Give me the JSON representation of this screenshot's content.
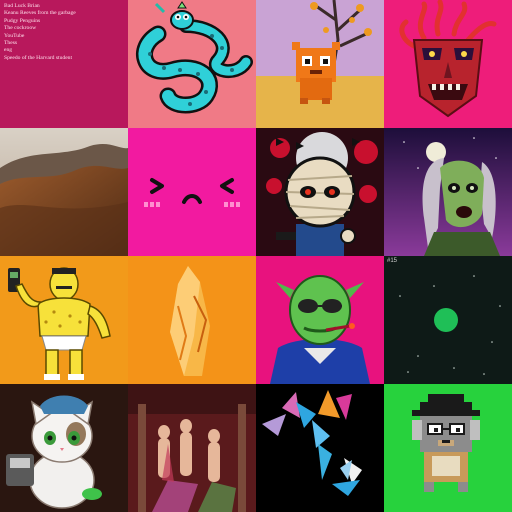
{
  "tiles": [
    {
      "id": "text-list",
      "bg": "#b8185c",
      "items": [
        "Bad Luck Brian",
        "Keanu Reeves from the garbage",
        "Pudgy Penguins",
        "The cockroow",
        "YouTube",
        "Thess",
        "eng",
        "Speedo of the Harvard student"
      ]
    },
    {
      "id": "cyan-serpent",
      "bg": "#f07a86",
      "icon": "serpent-icon"
    },
    {
      "id": "orange-voxel-creature",
      "bg": "#e2b54a",
      "icon": "voxel-creature-icon"
    },
    {
      "id": "red-tentacle-mask",
      "bg": "#ee1d7a",
      "icon": "mask-icon"
    },
    {
      "id": "desert-landscape",
      "bg": "#8a5632",
      "icon": "landscape-icon"
    },
    {
      "id": "pink-kawaii-face",
      "bg": "#f21aa0",
      "icon": "face-icon"
    },
    {
      "id": "mummy-character",
      "bg": "#3a0c12",
      "icon": "mummy-icon"
    },
    {
      "id": "green-zombie",
      "bg": "#3c1560",
      "icon": "zombie-icon"
    },
    {
      "id": "yellow-muscle-man",
      "bg": "#f29a1a",
      "icon": "muscle-man-icon"
    },
    {
      "id": "amber-crystal",
      "bg": "#f49318",
      "icon": "crystal-icon"
    },
    {
      "id": "green-vampire",
      "bg": "#e8127e",
      "icon": "vampire-icon"
    },
    {
      "id": "green-orb-space",
      "bg": "#0e1a17",
      "label": "#15",
      "icon": "orb-icon"
    },
    {
      "id": "lucky-cat",
      "bg": "#321b14",
      "icon": "cat-icon"
    },
    {
      "id": "classical-painting",
      "bg": "#6e1f20",
      "icon": "painting-icon"
    },
    {
      "id": "abstract-shards",
      "bg": "#000000",
      "icon": "shards-icon"
    },
    {
      "id": "pixel-dog",
      "bg": "#27d23d",
      "icon": "pixel-dog-icon"
    }
  ]
}
